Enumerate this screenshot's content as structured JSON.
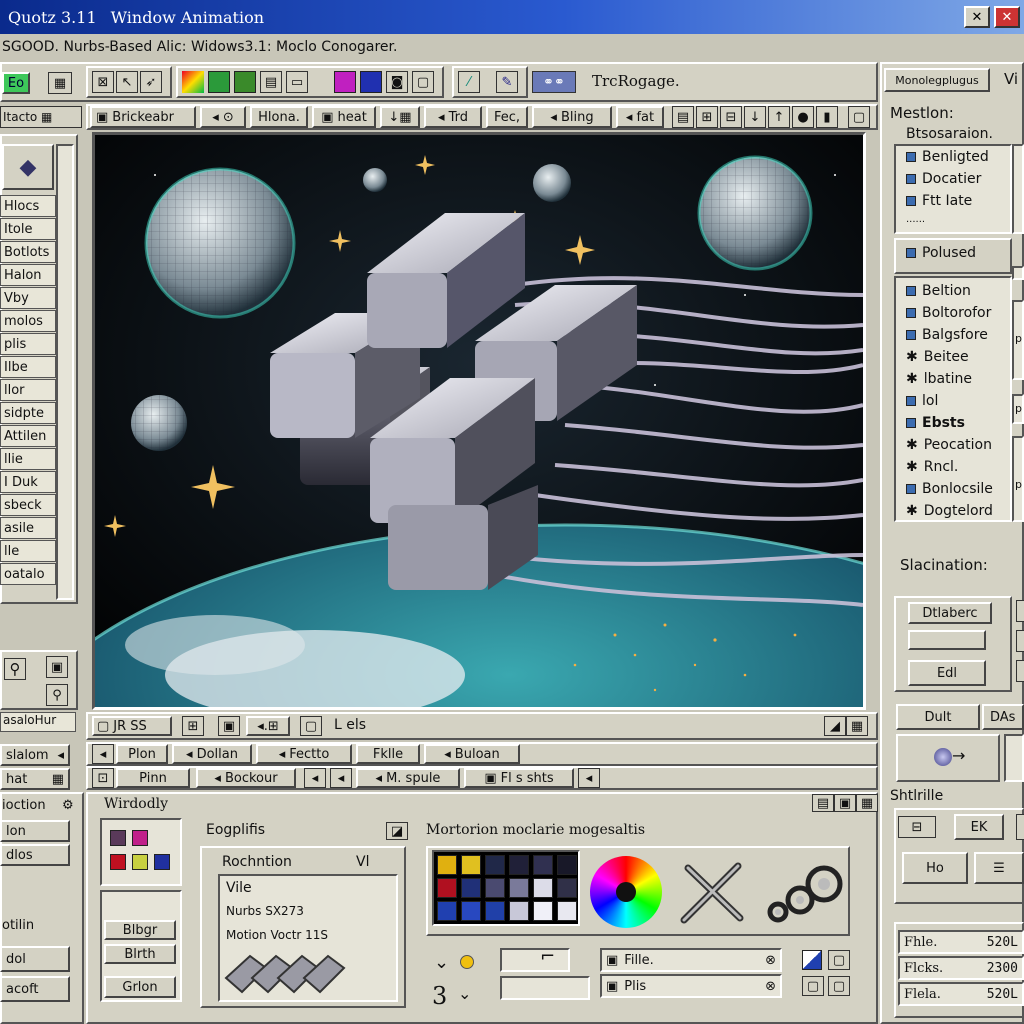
{
  "window": {
    "title": "Quotz 3.11",
    "subtitle": "Window Animation",
    "minimize_icon": "minimize-icon",
    "close_icon": "close-icon"
  },
  "menubar": {
    "text": "SGOOD.  Nurbs-Based  Alic:  Widows3.1:   Moclo  Conogarer."
  },
  "toolbar": {
    "eo_label": "Eo",
    "trackage_label": "TrcRogage."
  },
  "subtoolbar": {
    "items": [
      "Brickeabr",
      "Hlona.",
      "heat",
      "Trd",
      "Fec,",
      "Bling",
      "fat"
    ]
  },
  "left_panel": {
    "items": [
      "Hlocs",
      "Itole",
      "Botlots",
      "Halon",
      "Vby",
      "molos",
      "plis",
      "Ilbe",
      "llor",
      "sidpte",
      "Attilen",
      "llie",
      "I Duk",
      "sbeck",
      "asile",
      "lle",
      "oatalo"
    ],
    "status_label": "asaloHur",
    "bottom_items": [
      "slalom",
      "hat"
    ]
  },
  "viewport_toolbar_1": {
    "label": "JR  SS",
    "label2": "L els"
  },
  "viewport_toolbar_2": {
    "items": [
      "Plon",
      "Dollan",
      "Fectto",
      "Fklle",
      "Buloan"
    ]
  },
  "viewport_toolbar_3": {
    "items": [
      "Pinn",
      "Bockour",
      "M. spule",
      "Fl s shts"
    ]
  },
  "bottom_left": {
    "items": [
      "ioction",
      "lon",
      "dlos",
      "otilin",
      "dol",
      "acoft"
    ]
  },
  "window_panel": {
    "title": "Wirdodly",
    "ergo_label": "Eogplifis",
    "buttons": [
      "Blbgr",
      "Blrth",
      "Grlon"
    ],
    "roto_title": "Rochntion",
    "roto_view": "Vl",
    "lines": [
      "Vile",
      "Nurbs SX273",
      "Motion Voctr    11S"
    ]
  },
  "motion_panel": {
    "title": "Mortorion moclarie mogesaltis",
    "file_rows": [
      "Fille.",
      "Plis"
    ],
    "num_label": "3"
  },
  "right_panel": {
    "top_button": "Monolegplugus",
    "top_letter": "Vi",
    "section_title": "Mestlon:",
    "section_sub": "Btsosaraion.",
    "group1": [
      "Benligted",
      "Docatier",
      "Ftt Iate"
    ],
    "group1_extra": "......",
    "group2_title": "Polused",
    "group2": [
      "Beltion",
      "Boltorofor",
      "Balgsfore",
      "Beitee",
      "lbatine",
      "lol"
    ],
    "group3_title": "Ebsts",
    "group3": [
      "Peocation",
      "Rncl.",
      "Bonlocsile",
      "Dogtelord"
    ],
    "side_letters": [
      "p",
      "p",
      "p"
    ],
    "selection_label": "Slacination:",
    "btns": [
      "Dtlaberc",
      "Edl",
      "Dult",
      "DAs"
    ],
    "shift_label": "Shtlrille",
    "shift_btns": [
      "EK",
      "Ho"
    ],
    "files": [
      {
        "name": "Fhle.",
        "value": "520L"
      },
      {
        "name": "Flcks.",
        "value": "2300"
      },
      {
        "name": "Flela.",
        "value": "520L"
      }
    ]
  }
}
